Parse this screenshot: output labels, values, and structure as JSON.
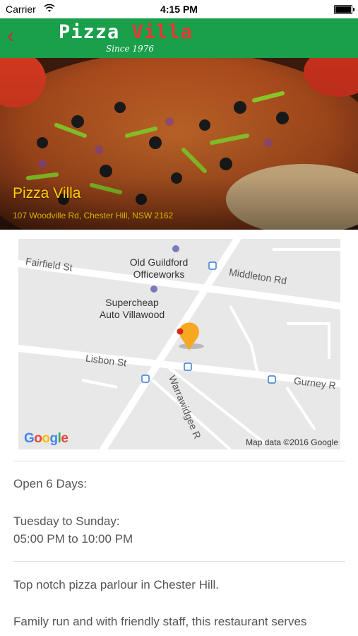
{
  "status_bar": {
    "carrier": "Carrier",
    "time": "4:15 PM"
  },
  "nav": {
    "back_icon": "chevron-left-icon",
    "logo_word1": "Pizza",
    "logo_word2": "Villa",
    "logo_tagline": "Since 1976"
  },
  "hero": {
    "title": "Pizza Villa",
    "address": "107 Woodville Rd, Chester Hill, NSW 2162"
  },
  "map": {
    "pois": {
      "officeworks": "Old Guildford\nOfficeworks",
      "supercheap": "Supercheap\nAuto Villawood"
    },
    "streets": {
      "fairfield": "Fairfield St",
      "middleton": "Middleton Rd",
      "lisbon": "Lisbon St",
      "gurney": "Gurney R",
      "warrawidgee": "Warrawidgee R"
    },
    "attribution": "Map data ©2016 Google",
    "logo": "Google"
  },
  "details": {
    "open_days": "Open 6 Days:",
    "hours_days": "Tuesday to Sunday:",
    "hours_time": "05:00 PM to 10:00 PM",
    "tagline": "Top notch pizza parlour in Chester Hill.",
    "description": "Family run and with friendly staff, this restaurant serves"
  },
  "colors": {
    "brand_green": "#1a9f4b",
    "accent_red": "#e53935",
    "title_yellow": "#ffd000"
  }
}
